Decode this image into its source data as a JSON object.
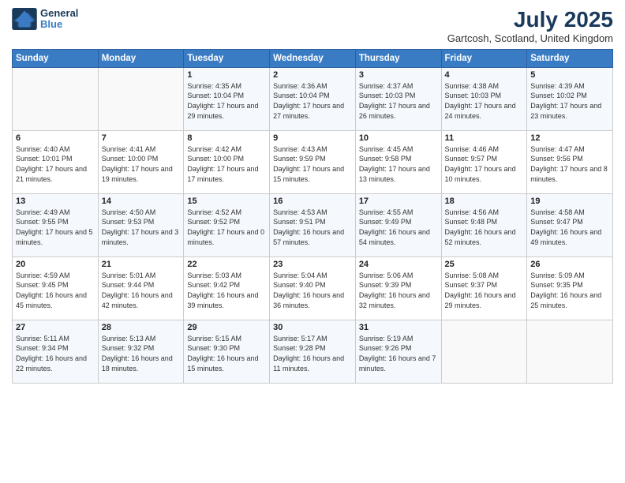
{
  "logo": {
    "line1": "General",
    "line2": "Blue"
  },
  "title": "July 2025",
  "location": "Gartcosh, Scotland, United Kingdom",
  "days_of_week": [
    "Sunday",
    "Monday",
    "Tuesday",
    "Wednesday",
    "Thursday",
    "Friday",
    "Saturday"
  ],
  "weeks": [
    [
      {
        "day": "",
        "info": ""
      },
      {
        "day": "",
        "info": ""
      },
      {
        "day": "1",
        "info": "Sunrise: 4:35 AM\nSunset: 10:04 PM\nDaylight: 17 hours and 29 minutes."
      },
      {
        "day": "2",
        "info": "Sunrise: 4:36 AM\nSunset: 10:04 PM\nDaylight: 17 hours and 27 minutes."
      },
      {
        "day": "3",
        "info": "Sunrise: 4:37 AM\nSunset: 10:03 PM\nDaylight: 17 hours and 26 minutes."
      },
      {
        "day": "4",
        "info": "Sunrise: 4:38 AM\nSunset: 10:03 PM\nDaylight: 17 hours and 24 minutes."
      },
      {
        "day": "5",
        "info": "Sunrise: 4:39 AM\nSunset: 10:02 PM\nDaylight: 17 hours and 23 minutes."
      }
    ],
    [
      {
        "day": "6",
        "info": "Sunrise: 4:40 AM\nSunset: 10:01 PM\nDaylight: 17 hours and 21 minutes."
      },
      {
        "day": "7",
        "info": "Sunrise: 4:41 AM\nSunset: 10:00 PM\nDaylight: 17 hours and 19 minutes."
      },
      {
        "day": "8",
        "info": "Sunrise: 4:42 AM\nSunset: 10:00 PM\nDaylight: 17 hours and 17 minutes."
      },
      {
        "day": "9",
        "info": "Sunrise: 4:43 AM\nSunset: 9:59 PM\nDaylight: 17 hours and 15 minutes."
      },
      {
        "day": "10",
        "info": "Sunrise: 4:45 AM\nSunset: 9:58 PM\nDaylight: 17 hours and 13 minutes."
      },
      {
        "day": "11",
        "info": "Sunrise: 4:46 AM\nSunset: 9:57 PM\nDaylight: 17 hours and 10 minutes."
      },
      {
        "day": "12",
        "info": "Sunrise: 4:47 AM\nSunset: 9:56 PM\nDaylight: 17 hours and 8 minutes."
      }
    ],
    [
      {
        "day": "13",
        "info": "Sunrise: 4:49 AM\nSunset: 9:55 PM\nDaylight: 17 hours and 5 minutes."
      },
      {
        "day": "14",
        "info": "Sunrise: 4:50 AM\nSunset: 9:53 PM\nDaylight: 17 hours and 3 minutes."
      },
      {
        "day": "15",
        "info": "Sunrise: 4:52 AM\nSunset: 9:52 PM\nDaylight: 17 hours and 0 minutes."
      },
      {
        "day": "16",
        "info": "Sunrise: 4:53 AM\nSunset: 9:51 PM\nDaylight: 16 hours and 57 minutes."
      },
      {
        "day": "17",
        "info": "Sunrise: 4:55 AM\nSunset: 9:49 PM\nDaylight: 16 hours and 54 minutes."
      },
      {
        "day": "18",
        "info": "Sunrise: 4:56 AM\nSunset: 9:48 PM\nDaylight: 16 hours and 52 minutes."
      },
      {
        "day": "19",
        "info": "Sunrise: 4:58 AM\nSunset: 9:47 PM\nDaylight: 16 hours and 49 minutes."
      }
    ],
    [
      {
        "day": "20",
        "info": "Sunrise: 4:59 AM\nSunset: 9:45 PM\nDaylight: 16 hours and 45 minutes."
      },
      {
        "day": "21",
        "info": "Sunrise: 5:01 AM\nSunset: 9:44 PM\nDaylight: 16 hours and 42 minutes."
      },
      {
        "day": "22",
        "info": "Sunrise: 5:03 AM\nSunset: 9:42 PM\nDaylight: 16 hours and 39 minutes."
      },
      {
        "day": "23",
        "info": "Sunrise: 5:04 AM\nSunset: 9:40 PM\nDaylight: 16 hours and 36 minutes."
      },
      {
        "day": "24",
        "info": "Sunrise: 5:06 AM\nSunset: 9:39 PM\nDaylight: 16 hours and 32 minutes."
      },
      {
        "day": "25",
        "info": "Sunrise: 5:08 AM\nSunset: 9:37 PM\nDaylight: 16 hours and 29 minutes."
      },
      {
        "day": "26",
        "info": "Sunrise: 5:09 AM\nSunset: 9:35 PM\nDaylight: 16 hours and 25 minutes."
      }
    ],
    [
      {
        "day": "27",
        "info": "Sunrise: 5:11 AM\nSunset: 9:34 PM\nDaylight: 16 hours and 22 minutes."
      },
      {
        "day": "28",
        "info": "Sunrise: 5:13 AM\nSunset: 9:32 PM\nDaylight: 16 hours and 18 minutes."
      },
      {
        "day": "29",
        "info": "Sunrise: 5:15 AM\nSunset: 9:30 PM\nDaylight: 16 hours and 15 minutes."
      },
      {
        "day": "30",
        "info": "Sunrise: 5:17 AM\nSunset: 9:28 PM\nDaylight: 16 hours and 11 minutes."
      },
      {
        "day": "31",
        "info": "Sunrise: 5:19 AM\nSunset: 9:26 PM\nDaylight: 16 hours and 7 minutes."
      },
      {
        "day": "",
        "info": ""
      },
      {
        "day": "",
        "info": ""
      }
    ]
  ]
}
